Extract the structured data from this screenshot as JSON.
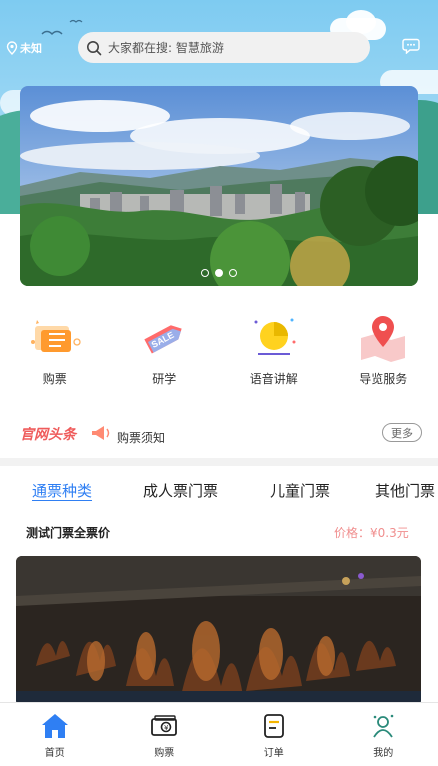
{
  "header": {
    "location": "未知",
    "search_placeholder": "大家都在搜: 智慧旅游"
  },
  "banner": {
    "slide_count": 3,
    "active_slide": 2
  },
  "entries": [
    {
      "label": "购票",
      "icon": "ticket-icon"
    },
    {
      "label": "研学",
      "icon": "sale-tag-icon"
    },
    {
      "label": "语音讲解",
      "icon": "audio-guide-icon"
    },
    {
      "label": "导览服务",
      "icon": "map-pin-icon"
    }
  ],
  "news": {
    "title": "官网头条",
    "text": "购票须知",
    "more_label": "更多"
  },
  "tabs": [
    "通票种类",
    "成人票门票",
    "儿童门票",
    "其他门票"
  ],
  "active_tab": 0,
  "ticket": {
    "name": "测试门票全票价",
    "price": "价格：¥0.3元"
  },
  "bottom_nav": [
    {
      "label": "首页",
      "icon": "home-icon"
    },
    {
      "label": "购票",
      "icon": "ticket-icon"
    },
    {
      "label": "订单",
      "icon": "order-icon"
    },
    {
      "label": "我的",
      "icon": "user-icon"
    }
  ],
  "colors": {
    "accent": "#2f7ff3",
    "headline_red": "#ef5b5b",
    "price": "#f08e8e",
    "sky": "#7ecbf1"
  }
}
